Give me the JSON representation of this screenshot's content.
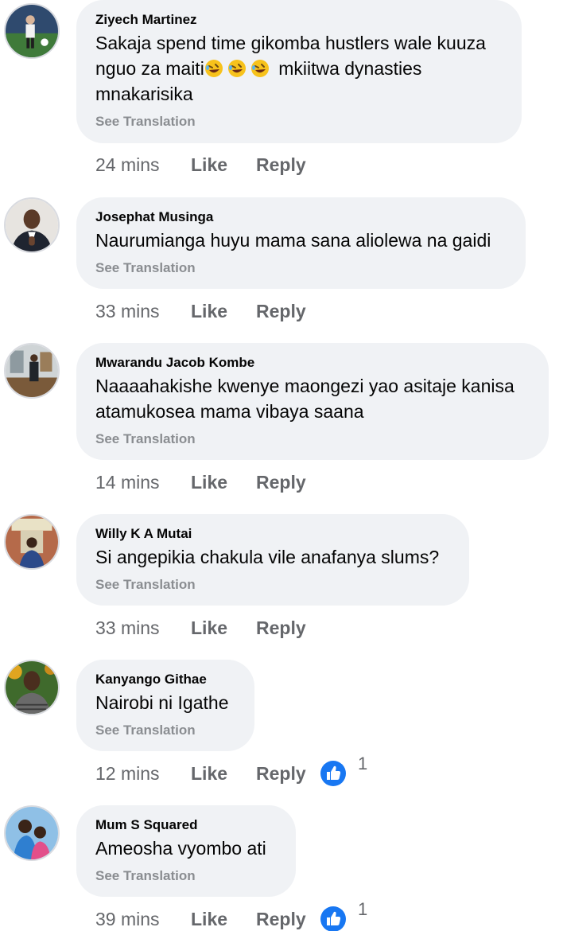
{
  "comments": [
    {
      "author": "Ziyech Martinez",
      "text": "Sakaja spend time gikomba hustlers wale kuuza nguo za maiti",
      "text_after_emoji": " mkiitwa dynasties mnakarisika",
      "emoji": [
        "rolling-on-floor-laughing",
        "rolling-on-floor-laughing",
        "rolling-on-floor-laughing"
      ],
      "see_translation": "See Translation",
      "time": "24 mins",
      "like_label": "Like",
      "reply_label": "Reply"
    },
    {
      "author": "Josephat Musinga",
      "text": "Naurumianga huyu mama sana aliolewa na gaidi",
      "see_translation": "See Translation",
      "time": "33 mins",
      "like_label": "Like",
      "reply_label": "Reply"
    },
    {
      "author": "Mwarandu Jacob Kombe",
      "text": "Naaaahakishe kwenye maongezi yao asitaje kanisa atamukosea mama vibaya saana",
      "see_translation": "See Translation",
      "time": "14 mins",
      "like_label": "Like",
      "reply_label": "Reply"
    },
    {
      "author": "Willy K A Mutai",
      "text": "Si angepikia chakula vile anafanya slums?",
      "see_translation": "See Translation",
      "time": "33 mins",
      "like_label": "Like",
      "reply_label": "Reply"
    },
    {
      "author": "Kanyango Githae",
      "text": "Nairobi ni Igathe",
      "see_translation": "See Translation",
      "time": "12 mins",
      "like_label": "Like",
      "reply_label": "Reply",
      "reaction_icon": "like-reaction-icon",
      "reaction_count": "1"
    },
    {
      "author": "Mum S Squared",
      "text": "Ameosha vyombo ati",
      "see_translation": "See Translation",
      "time": "39 mins",
      "like_label": "Like",
      "reply_label": "Reply",
      "reaction_icon": "like-reaction-icon",
      "reaction_count": "1"
    }
  ],
  "colors": {
    "bubble_bg": "#f0f2f5",
    "text": "#050505",
    "secondary": "#65676b",
    "see_translation": "#8a8d91",
    "like_blue": "#1877f2"
  }
}
